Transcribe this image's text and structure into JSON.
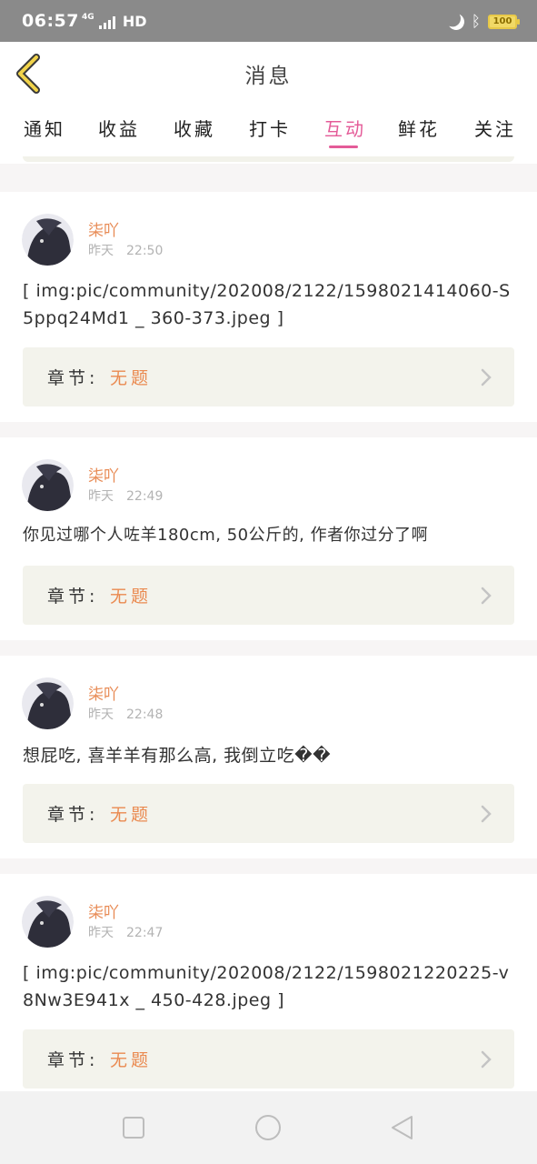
{
  "status_bar": {
    "time": "06:57",
    "network_small": "4G",
    "network": "HD",
    "battery": "100"
  },
  "header": {
    "title": "消息"
  },
  "tabs": [
    {
      "label": "通知",
      "active": false
    },
    {
      "label": "收益",
      "active": false
    },
    {
      "label": "收藏",
      "active": false
    },
    {
      "label": "打卡",
      "active": false
    },
    {
      "label": "互动",
      "active": true
    },
    {
      "label": "鲜花",
      "active": false
    },
    {
      "label": "关注",
      "active": false
    }
  ],
  "messages": [
    {
      "username": "柒吖",
      "date": "昨天",
      "time": "22:50",
      "content": "[ img:pic/community/202008/2122/1598021414060-S5ppq24Md1 _ 360-373.jpeg ]",
      "chapter_label": "章节:",
      "chapter_value": "无题"
    },
    {
      "username": "柒吖",
      "date": "昨天",
      "time": "22:49",
      "content": "你见过哪个人咗羊180cm, 50公斤的, 作者你过分了啊",
      "chapter_label": "章节:",
      "chapter_value": "无题"
    },
    {
      "username": "柒吖",
      "date": "昨天",
      "time": "22:48",
      "content": "想屁吃, 喜羊羊有那么高, 我倒立吃��",
      "chapter_label": "章节:",
      "chapter_value": "无题"
    },
    {
      "username": "柒吖",
      "date": "昨天",
      "time": "22:47",
      "content": "[ img:pic/community/202008/2122/1598021220225-v8Nw3E941x _ 450-428.jpeg ]",
      "chapter_label": "章节:",
      "chapter_value": "无题"
    }
  ],
  "colors": {
    "accent": "#e45b98",
    "username": "#e88b55",
    "chapter_value": "#ea8a50",
    "back_arrow": "#f1d34a"
  },
  "icons": {
    "back": "chevron-left-icon",
    "chapter_arrow": "chevron-right-icon",
    "nav": [
      "square-icon",
      "circle-icon",
      "triangle-left-icon"
    ]
  }
}
